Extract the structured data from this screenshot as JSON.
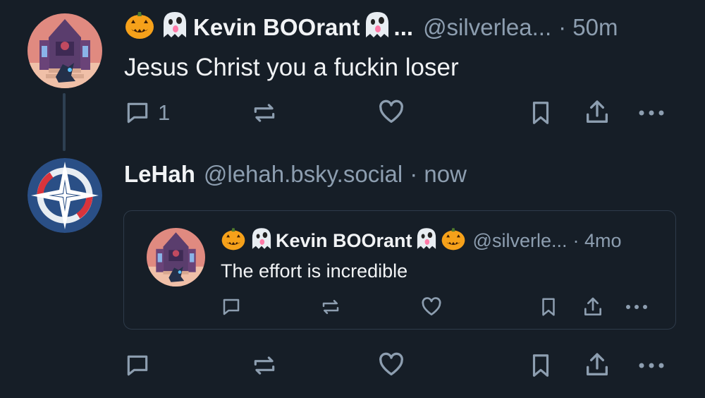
{
  "post1": {
    "display_name": "Kevin BOOrant",
    "name_suffix": "...",
    "handle": "@silverlea...",
    "time": "· 50m",
    "text": "Jesus Christ you a fuckin loser",
    "reply_count": "1"
  },
  "post2": {
    "display_name": "LeHah",
    "handle": "@lehah.bsky.social",
    "time": "· now"
  },
  "quote": {
    "display_name": "Kevin BOOrant",
    "handle": "@silverle...",
    "time": "· 4mo",
    "text": "The effort is incredible"
  },
  "colors": {
    "background": "#161e27",
    "muted": "#8d9eb0",
    "text": "#f1f3f5",
    "pumpkin": "#f6a11a",
    "lehah_avatar_bg": "#2a4f86",
    "lehah_avatar_ring": "#d9343c"
  },
  "icons": [
    "pumpkin-icon",
    "ghost-icon",
    "reply-icon",
    "repost-icon",
    "like-icon",
    "bookmark-icon",
    "share-icon",
    "more-icon"
  ]
}
